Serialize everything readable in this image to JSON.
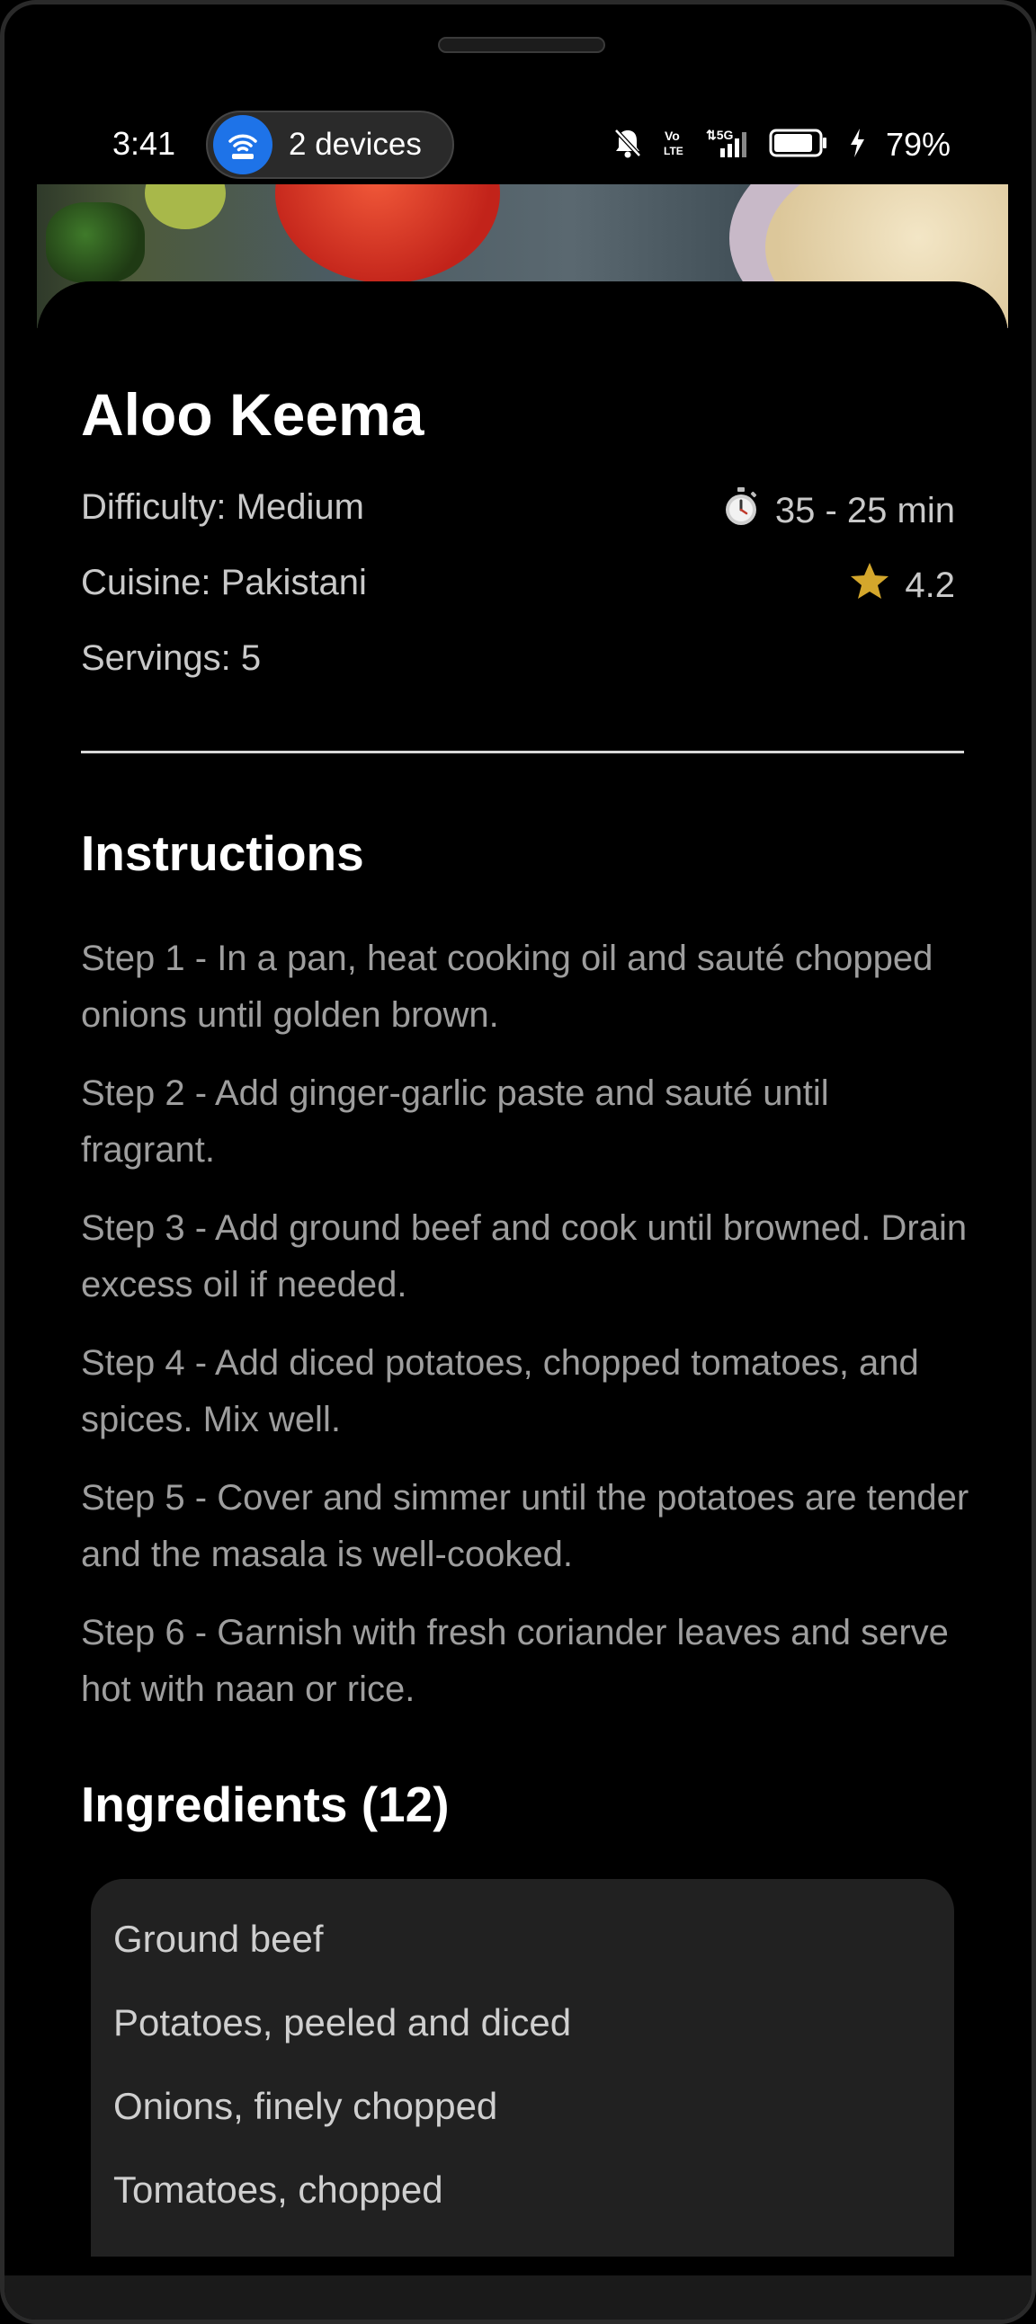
{
  "status_bar": {
    "time": "3:41",
    "devices_label": "2 devices",
    "battery_percent": "79%",
    "network_label": "5G",
    "volte_label": "Vo LTE",
    "icons": [
      "wifi-hotspot-icon",
      "silent-bell-icon",
      "volte-icon",
      "signal-5g-icon",
      "battery-icon",
      "charging-bolt-icon"
    ]
  },
  "recipe": {
    "title": "Aloo Keema",
    "difficulty": "Difficulty: Medium",
    "cuisine": "Cuisine: Pakistani",
    "servings": "Servings: 5",
    "time": "35 - 25 min",
    "rating": "4.2",
    "rating_color": "#d4a72c"
  },
  "instructions": {
    "heading": "Instructions",
    "steps": [
      "Step 1 - In a pan, heat cooking oil and sauté chopped onions until golden brown.",
      "Step 2 - Add ginger-garlic paste and sauté until fragrant.",
      "Step 3 - Add ground beef and cook until browned. Drain excess oil if needed.",
      "Step 4 - Add diced potatoes, chopped tomatoes, and spices. Mix well.",
      "Step 5 - Cover and simmer until the potatoes are tender and the masala is well-cooked.",
      "Step 6 - Garnish with fresh coriander leaves and serve hot with naan or rice."
    ]
  },
  "ingredients": {
    "heading": "Ingredients (12)",
    "items": [
      "Ground beef",
      "Potatoes, peeled and diced",
      "Onions, finely chopped",
      "Tomatoes, chopped"
    ]
  }
}
